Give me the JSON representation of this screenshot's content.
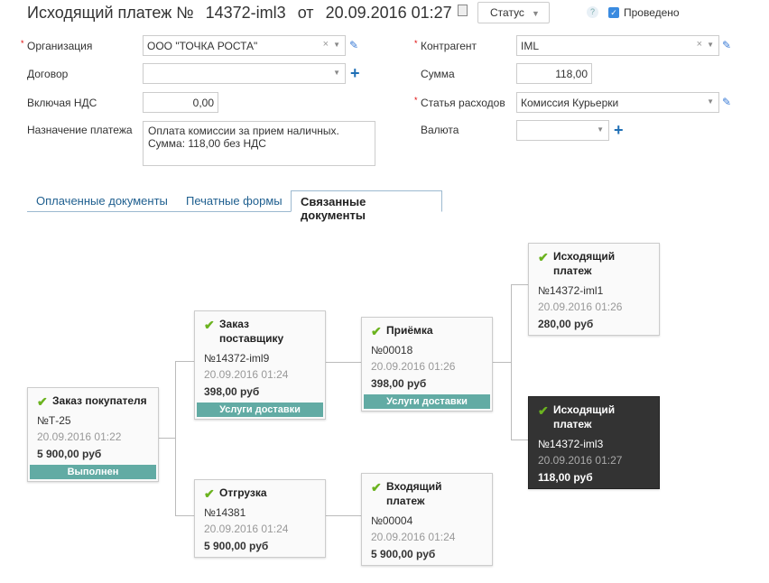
{
  "header": {
    "doc_type": "Исходящий платеж №",
    "number": "14372-iml3",
    "from": "от",
    "date": "20.09.2016 01:27",
    "status_label": "Статус",
    "help": "?",
    "posted_label": "Проведено"
  },
  "form": {
    "organization": {
      "label": "Организация",
      "value": "ООО \"ТОЧКА РОСТА\""
    },
    "contract": {
      "label": "Договор",
      "value": ""
    },
    "vat": {
      "label": "Включая НДС",
      "value": "0,00"
    },
    "purpose": {
      "label": "Назначение платежа",
      "value": "Оплата комиссии за прием наличных.\nСумма: 118,00 без НДС"
    },
    "counterparty": {
      "label": "Контрагент",
      "value": "IML"
    },
    "amount": {
      "label": "Сумма",
      "value": "118,00"
    },
    "expense_item": {
      "label": "Статья расходов",
      "value": "Комиссия Курьерки"
    },
    "currency": {
      "label": "Валюта",
      "value": ""
    }
  },
  "tabs": [
    "Оплаченные документы",
    "Печатные формы",
    "Связанные документы"
  ],
  "cards": [
    {
      "title": "Заказ покупателя",
      "number": "№Т-25",
      "date": "20.09.2016 01:22",
      "sum": "5 900,00 руб",
      "badge": "Выполнен"
    },
    {
      "title": "Заказ поставщику",
      "number": "№14372-iml9",
      "date": "20.09.2016 01:24",
      "sum": "398,00 руб",
      "badge": "Услуги доставки"
    },
    {
      "title": "Приёмка",
      "number": "№00018",
      "date": "20.09.2016 01:26",
      "sum": "398,00 руб",
      "badge": "Услуги доставки"
    },
    {
      "title": "Отгрузка",
      "number": "№14381",
      "date": "20.09.2016 01:24",
      "sum": "5 900,00 руб"
    },
    {
      "title": "Входящий платеж",
      "number": "№00004",
      "date": "20.09.2016 01:24",
      "sum": "5 900,00 руб"
    },
    {
      "title": "Исходящий платеж",
      "number": "№14372-iml1",
      "date": "20.09.2016 01:26",
      "sum": "280,00 руб"
    },
    {
      "title": "Исходящий платеж",
      "number": "№14372-iml3",
      "date": "20.09.2016 01:27",
      "sum": "118,00 руб"
    }
  ]
}
